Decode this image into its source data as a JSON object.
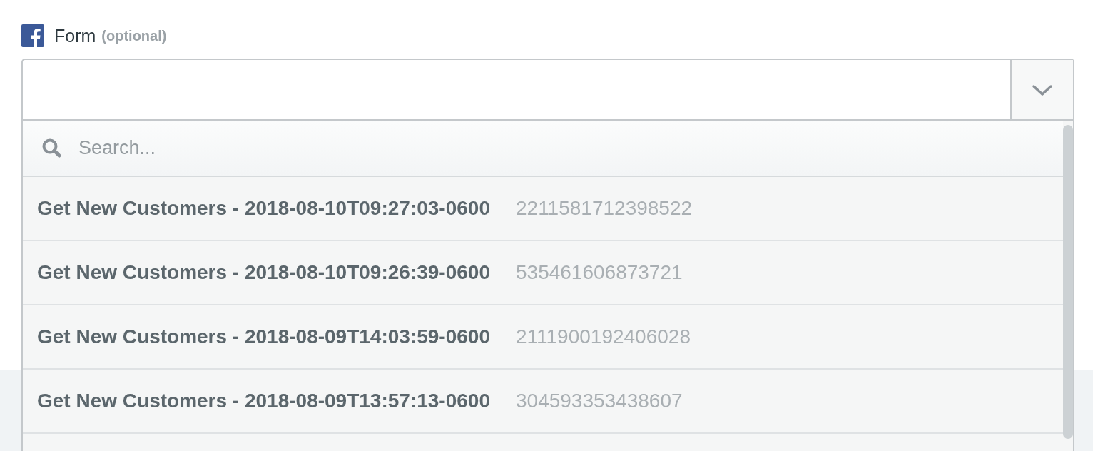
{
  "field": {
    "label": "Form",
    "hint": "(optional)"
  },
  "search": {
    "placeholder": "Search..."
  },
  "options": [
    {
      "title": "Get New Customers - 2018-08-10T09:27:03-0600",
      "id": "2211581712398522"
    },
    {
      "title": "Get New Customers - 2018-08-10T09:26:39-0600",
      "id": "535461606873721"
    },
    {
      "title": "Get New Customers - 2018-08-09T14:03:59-0600",
      "id": "2111900192406028"
    },
    {
      "title": "Get New Customers - 2018-08-09T13:57:13-0600",
      "id": "304593353438607"
    }
  ]
}
